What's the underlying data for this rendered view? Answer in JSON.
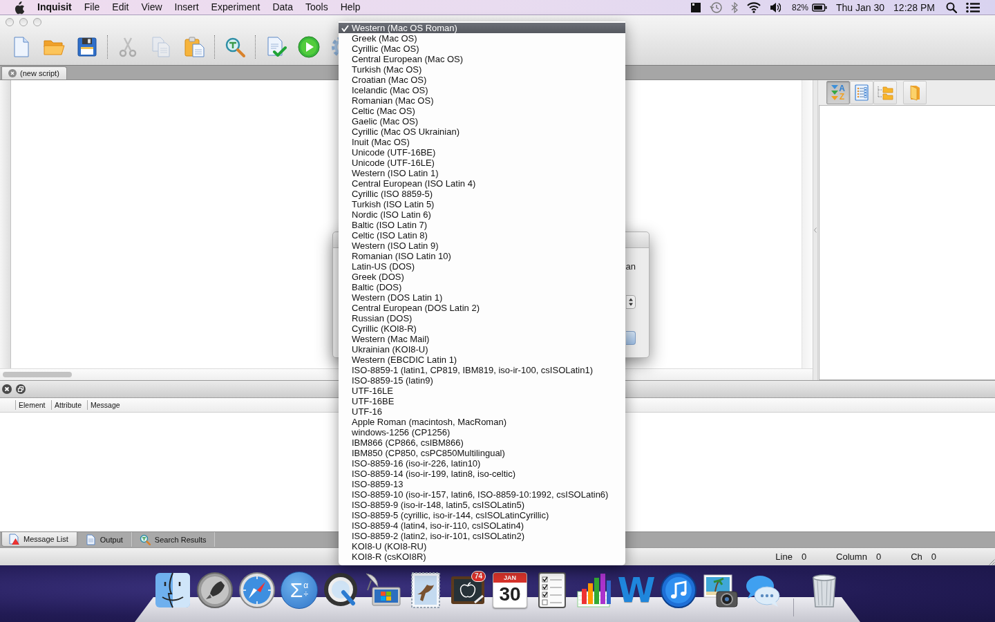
{
  "menubar": {
    "app": "Inquisit",
    "menus": [
      "File",
      "Edit",
      "View",
      "Insert",
      "Experiment",
      "Data",
      "Tools",
      "Help"
    ],
    "battery": "82%",
    "date": "Thu Jan 30",
    "time": "12:28 PM"
  },
  "toolbar": [
    {
      "kind": "new",
      "disabled": false
    },
    {
      "kind": "open",
      "disabled": false
    },
    {
      "kind": "save",
      "disabled": false
    },
    {
      "kind": "separator"
    },
    {
      "kind": "cut",
      "disabled": true
    },
    {
      "kind": "copy",
      "disabled": true
    },
    {
      "kind": "paste",
      "disabled": false
    },
    {
      "kind": "separator"
    },
    {
      "kind": "find",
      "disabled": false
    },
    {
      "kind": "separator"
    },
    {
      "kind": "check",
      "disabled": false
    },
    {
      "kind": "run",
      "disabled": false
    },
    {
      "kind": "settings",
      "disabled": false
    }
  ],
  "editor_tabs": [
    {
      "label": "(new script)",
      "selected": true
    }
  ],
  "outline_panel": {
    "buttons": [
      {
        "kind": "sort",
        "glyphs": [
          "A",
          "Z"
        ],
        "selected": true
      },
      {
        "kind": "list",
        "selected": false
      },
      {
        "kind": "tree",
        "selected": false
      },
      {
        "kind": "folder",
        "selected": false
      }
    ]
  },
  "message_table": {
    "columns": [
      "Element",
      "Attribute",
      "Message"
    ]
  },
  "bottom_tabs": [
    {
      "label": "Message List",
      "kind": "warning",
      "selected": true
    },
    {
      "label": "Output",
      "kind": "document",
      "selected": false
    },
    {
      "label": "Search Results",
      "kind": "search",
      "selected": false
    }
  ],
  "status_bar": [
    {
      "label": "Line",
      "value": "0"
    },
    {
      "label": "Column",
      "value": "0"
    },
    {
      "label": "Ch",
      "value": "0"
    }
  ],
  "dialog": {
    "message": "an"
  },
  "encoding_menu": {
    "items": [
      {
        "label": "Western (Mac OS Roman)",
        "checked": true,
        "highlighted": true
      },
      {
        "label": "Greek (Mac OS)",
        "checked": false,
        "highlighted": false
      },
      {
        "label": "Cyrillic (Mac OS)",
        "checked": false,
        "highlighted": false
      },
      {
        "label": "Central European (Mac OS)",
        "checked": false,
        "highlighted": false
      },
      {
        "label": "Turkish (Mac OS)",
        "checked": false,
        "highlighted": false
      },
      {
        "label": "Croatian (Mac OS)",
        "checked": false,
        "highlighted": false
      },
      {
        "label": "Icelandic (Mac OS)",
        "checked": false,
        "highlighted": false
      },
      {
        "label": "Romanian (Mac OS)",
        "checked": false,
        "highlighted": false
      },
      {
        "label": "Celtic (Mac OS)",
        "checked": false,
        "highlighted": false
      },
      {
        "label": "Gaelic (Mac OS)",
        "checked": false,
        "highlighted": false
      },
      {
        "label": "Cyrillic (Mac OS Ukrainian)",
        "checked": false,
        "highlighted": false
      },
      {
        "label": "Inuit (Mac OS)",
        "checked": false,
        "highlighted": false
      },
      {
        "label": "Unicode (UTF-16BE)",
        "checked": false,
        "highlighted": false
      },
      {
        "label": "Unicode (UTF-16LE)",
        "checked": false,
        "highlighted": false
      },
      {
        "label": "Western (ISO Latin 1)",
        "checked": false,
        "highlighted": false
      },
      {
        "label": "Central European (ISO Latin 4)",
        "checked": false,
        "highlighted": false
      },
      {
        "label": "Cyrillic (ISO 8859-5)",
        "checked": false,
        "highlighted": false
      },
      {
        "label": "Turkish (ISO Latin 5)",
        "checked": false,
        "highlighted": false
      },
      {
        "label": "Nordic (ISO Latin 6)",
        "checked": false,
        "highlighted": false
      },
      {
        "label": "Baltic (ISO Latin 7)",
        "checked": false,
        "highlighted": false
      },
      {
        "label": "Celtic (ISO Latin 8)",
        "checked": false,
        "highlighted": false
      },
      {
        "label": "Western (ISO Latin 9)",
        "checked": false,
        "highlighted": false
      },
      {
        "label": "Romanian (ISO Latin 10)",
        "checked": false,
        "highlighted": false
      },
      {
        "label": "Latin-US (DOS)",
        "checked": false,
        "highlighted": false
      },
      {
        "label": "Greek (DOS)",
        "checked": false,
        "highlighted": false
      },
      {
        "label": "Baltic (DOS)",
        "checked": false,
        "highlighted": false
      },
      {
        "label": "Western (DOS Latin 1)",
        "checked": false,
        "highlighted": false
      },
      {
        "label": "Central European (DOS Latin 2)",
        "checked": false,
        "highlighted": false
      },
      {
        "label": "Russian (DOS)",
        "checked": false,
        "highlighted": false
      },
      {
        "label": "Cyrillic (KOI8-R)",
        "checked": false,
        "highlighted": false
      },
      {
        "label": "Western (Mac Mail)",
        "checked": false,
        "highlighted": false
      },
      {
        "label": "Ukrainian (KOI8-U)",
        "checked": false,
        "highlighted": false
      },
      {
        "label": "Western (EBCDIC Latin 1)",
        "checked": false,
        "highlighted": false
      },
      {
        "label": "ISO-8859-1 (latin1, CP819, IBM819, iso-ir-100, csISOLatin1)",
        "checked": false,
        "highlighted": false
      },
      {
        "label": "ISO-8859-15 (latin9)",
        "checked": false,
        "highlighted": false
      },
      {
        "label": "UTF-16LE",
        "checked": false,
        "highlighted": false
      },
      {
        "label": "UTF-16BE",
        "checked": false,
        "highlighted": false
      },
      {
        "label": "UTF-16",
        "checked": false,
        "highlighted": false
      },
      {
        "label": "Apple Roman (macintosh, MacRoman)",
        "checked": false,
        "highlighted": false
      },
      {
        "label": "windows-1256 (CP1256)",
        "checked": false,
        "highlighted": false
      },
      {
        "label": "IBM866 (CP866, csIBM866)",
        "checked": false,
        "highlighted": false
      },
      {
        "label": "IBM850 (CP850, csPC850Multilingual)",
        "checked": false,
        "highlighted": false
      },
      {
        "label": "ISO-8859-16 (iso-ir-226, latin10)",
        "checked": false,
        "highlighted": false
      },
      {
        "label": "ISO-8859-14 (iso-ir-199, latin8, iso-celtic)",
        "checked": false,
        "highlighted": false
      },
      {
        "label": "ISO-8859-13",
        "checked": false,
        "highlighted": false
      },
      {
        "label": "ISO-8859-10 (iso-ir-157, latin6, ISO-8859-10:1992, csISOLatin6)",
        "checked": false,
        "highlighted": false
      },
      {
        "label": "ISO-8859-9 (iso-ir-148, latin5, csISOLatin5)",
        "checked": false,
        "highlighted": false
      },
      {
        "label": "ISO-8859-5 (cyrillic, iso-ir-144, csISOLatinCyrillic)",
        "checked": false,
        "highlighted": false
      },
      {
        "label": "ISO-8859-4 (latin4, iso-ir-110, csISOLatin4)",
        "checked": false,
        "highlighted": false
      },
      {
        "label": "ISO-8859-2 (latin2, iso-ir-101, csISOLatin2)",
        "checked": false,
        "highlighted": false
      },
      {
        "label": "KOI8-U (KOI8-RU)",
        "checked": false,
        "highlighted": false
      },
      {
        "label": "KOI8-R (csKOI8R)",
        "checked": false,
        "highlighted": false
      }
    ]
  },
  "dock": {
    "items": [
      {
        "kind": "face"
      },
      {
        "kind": "rocket"
      },
      {
        "kind": "compass"
      },
      {
        "kind": "sigma",
        "glyphs": [
          "Σ",
          "α",
          "÷"
        ]
      },
      {
        "kind": "dial"
      },
      {
        "kind": "satellite"
      },
      {
        "kind": "stamp"
      },
      {
        "kind": "chalkboard",
        "badge": "74"
      },
      {
        "kind": "calendar",
        "month": "JAN",
        "day": "30"
      },
      {
        "kind": "checklist"
      },
      {
        "kind": "chart"
      },
      {
        "kind": "wordmark",
        "glyph": "W"
      },
      {
        "kind": "music"
      },
      {
        "kind": "camera"
      },
      {
        "kind": "bubbles"
      },
      {
        "kind": "separator"
      },
      {
        "kind": "trash"
      }
    ]
  }
}
